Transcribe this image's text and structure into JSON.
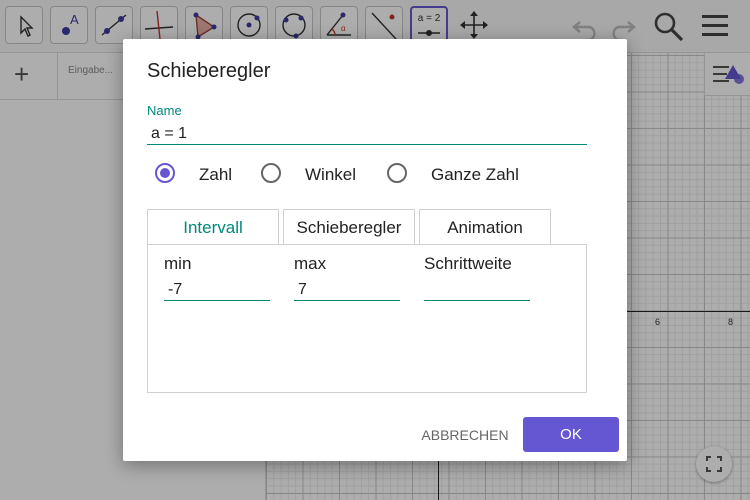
{
  "colors": {
    "accent": "#6557d2",
    "teal": "#00897b",
    "overlay": "rgba(0,0,0,0.32)"
  },
  "toolbar": {
    "tools": [
      {
        "name": "move-tool",
        "icon": "arrow-cursor-icon"
      },
      {
        "name": "point-tool",
        "icon": "point-icon"
      },
      {
        "name": "line-tool",
        "icon": "line-icon"
      },
      {
        "name": "perpendicular-tool",
        "icon": "perpendicular-line-icon"
      },
      {
        "name": "polygon-tool",
        "icon": "polygon-icon"
      },
      {
        "name": "circle-center-tool",
        "icon": "circle-center-icon"
      },
      {
        "name": "circle-3points-tool",
        "icon": "circle-points-icon"
      },
      {
        "name": "angle-tool",
        "icon": "angle-icon"
      },
      {
        "name": "reflect-tool",
        "icon": "reflect-icon"
      },
      {
        "name": "slider-tool",
        "icon": "slider-icon",
        "label": "a = 2"
      },
      {
        "name": "move-view-tool",
        "icon": "move-graphics-icon"
      }
    ],
    "right_icons": [
      "undo-icon",
      "redo-icon",
      "search-icon",
      "menu-icon"
    ]
  },
  "algebra": {
    "input_placeholder": "Eingabe..."
  },
  "graphics": {
    "x_tick_labels": [
      "6",
      "8"
    ]
  },
  "dialog": {
    "title": "Schieberegler",
    "name_label": "Name",
    "name_value": "a = 1",
    "radio_options": [
      {
        "label": "Zahl",
        "selected": true
      },
      {
        "label": "Winkel",
        "selected": false
      },
      {
        "label": "Ganze Zahl",
        "selected": false
      }
    ],
    "tabs": [
      {
        "label": "Intervall",
        "active": true
      },
      {
        "label": "Schieberegler",
        "active": false
      },
      {
        "label": "Animation",
        "active": false
      }
    ],
    "fields": [
      {
        "label": "min",
        "value": "-7"
      },
      {
        "label": "max",
        "value": "7"
      },
      {
        "label": "Schrittweite",
        "value": ""
      }
    ],
    "cancel_label": "ABBRECHEN",
    "ok_label": "OK"
  }
}
